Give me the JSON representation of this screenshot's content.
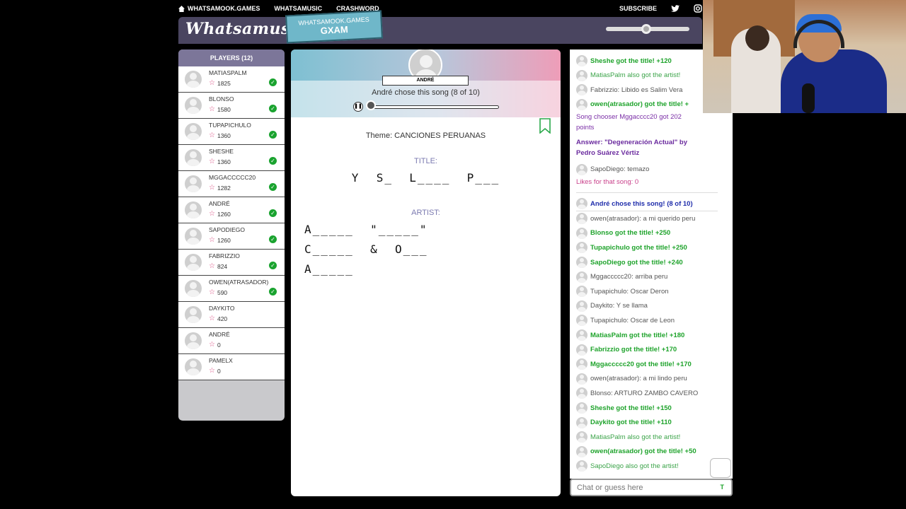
{
  "nav": {
    "links": [
      "WHATSAMOOK.GAMES",
      "WHATSAMUSIC",
      "CRASHWORD"
    ],
    "subscribe": "SUBSCRIBE"
  },
  "header": {
    "logo": "Whatsamusic",
    "badge_line1": "WHATSAMOOK.GAMES",
    "badge_line2": "GXAM"
  },
  "players": {
    "title": "PLAYERS (12)",
    "list": [
      {
        "name": "MATIASPALM",
        "score": "1825",
        "guessed": true
      },
      {
        "name": "BLONSO",
        "score": "1580",
        "guessed": true
      },
      {
        "name": "TUPAPICHULO",
        "score": "1360",
        "guessed": true
      },
      {
        "name": "SHESHE",
        "score": "1360",
        "guessed": true
      },
      {
        "name": "MGGACCCCC20",
        "score": "1282",
        "guessed": true
      },
      {
        "name": "ANDRÉ",
        "score": "1260",
        "guessed": true
      },
      {
        "name": "SAPODIEGO",
        "score": "1260",
        "guessed": true
      },
      {
        "name": "FABRIZZIO",
        "score": "824",
        "guessed": true
      },
      {
        "name": "OWEN(ATRASADOR)",
        "score": "590",
        "guessed": true
      },
      {
        "name": "DAYKITO",
        "score": "420",
        "guessed": false
      },
      {
        "name": "ANDRÉ",
        "score": "0",
        "guessed": false
      },
      {
        "name": "PAMELX",
        "score": "0",
        "guessed": false
      }
    ]
  },
  "round": {
    "chooser": "ANDRÉ",
    "chose_text": "André chose this song (8 of 10)",
    "progress_fraction": 0.01,
    "theme": "Theme: CANCIONES PERUANAS",
    "title_label": "TITLE:",
    "title_hint": "Y  S_  L____  P___",
    "artist_label": "ARTIST:",
    "artist_hint_lines": [
      "A_____  \"_____\"",
      "C_____  &  O___",
      "A_____"
    ]
  },
  "chat": {
    "lines": [
      {
        "text": "Sheshe got the title! +120",
        "style": "c-green",
        "avatar": true
      },
      {
        "text": "MatiasPalm also got the artist!",
        "style": "c-lgreen",
        "avatar": true
      },
      {
        "text": "Fabrizzio: Libido es Salim Vera",
        "style": "c-gray",
        "avatar": true
      },
      {
        "text": "owen(atrasador) got the title! +",
        "style": "c-green",
        "avatar": true
      },
      {
        "text": "Song chooser Mggacccc20 got 202",
        "style": "c-purple",
        "avatar": false
      },
      {
        "text": "points",
        "style": "c-purple",
        "avatar": false
      },
      {
        "text": "Answer: \"Degeneración Actual\" by",
        "style": "c-purpleb",
        "avatar": false
      },
      {
        "text": "Pedro Suárez Vértiz",
        "style": "c-purpleb",
        "avatar": false
      },
      {
        "text": "SapoDiego: temazo",
        "style": "c-gray",
        "avatar": true
      },
      {
        "text": "Likes for that song: 0",
        "style": "c-pink",
        "avatar": false
      },
      {
        "text": "André chose this song! (8 of 10)",
        "style": "c-blue",
        "avatar": true
      },
      {
        "text": "owen(atrasador): a mi querido peru",
        "style": "c-gray",
        "avatar": true
      },
      {
        "text": "Blonso got the title! +250",
        "style": "c-green",
        "avatar": true
      },
      {
        "text": "Tupapichulo got the title! +250",
        "style": "c-green",
        "avatar": true
      },
      {
        "text": "SapoDiego got the title! +240",
        "style": "c-green",
        "avatar": true
      },
      {
        "text": "Mggaccccc20: arriba peru",
        "style": "c-gray",
        "avatar": true
      },
      {
        "text": "Tupapichulo: Oscar Deron",
        "style": "c-gray",
        "avatar": true
      },
      {
        "text": "Daykito: Y se llama",
        "style": "c-gray",
        "avatar": true
      },
      {
        "text": "Tupapichulo: Oscar de Leon",
        "style": "c-gray",
        "avatar": true
      },
      {
        "text": "MatiasPalm got the title! +180",
        "style": "c-green",
        "avatar": true
      },
      {
        "text": "Fabrizzio got the title! +170",
        "style": "c-green",
        "avatar": true
      },
      {
        "text": "Mggaccccc20 got the title! +170",
        "style": "c-green",
        "avatar": true
      },
      {
        "text": "owen(atrasador): a mi lindo peru",
        "style": "c-gray",
        "avatar": true
      },
      {
        "text": "Blonso: ARTURO ZAMBO CAVERO",
        "style": "c-gray",
        "avatar": true
      },
      {
        "text": "Sheshe got the title! +150",
        "style": "c-green",
        "avatar": true
      },
      {
        "text": "Daykito got the title! +110",
        "style": "c-green",
        "avatar": true
      },
      {
        "text": "MatiasPalm also got the artist!",
        "style": "c-lgreen",
        "avatar": true
      },
      {
        "text": "owen(atrasador) got the title! +50",
        "style": "c-green",
        "avatar": true
      },
      {
        "text": "SapoDiego also got the artist!",
        "style": "c-lgreen",
        "avatar": true
      }
    ],
    "input_placeholder": "Chat or guess here",
    "send_label": "T"
  },
  "colors": {
    "header_bg": "#4a4560",
    "players_head": "#7c7699",
    "guess_green": "#1ea32b",
    "chooser_purple": "#7a2ea6"
  }
}
